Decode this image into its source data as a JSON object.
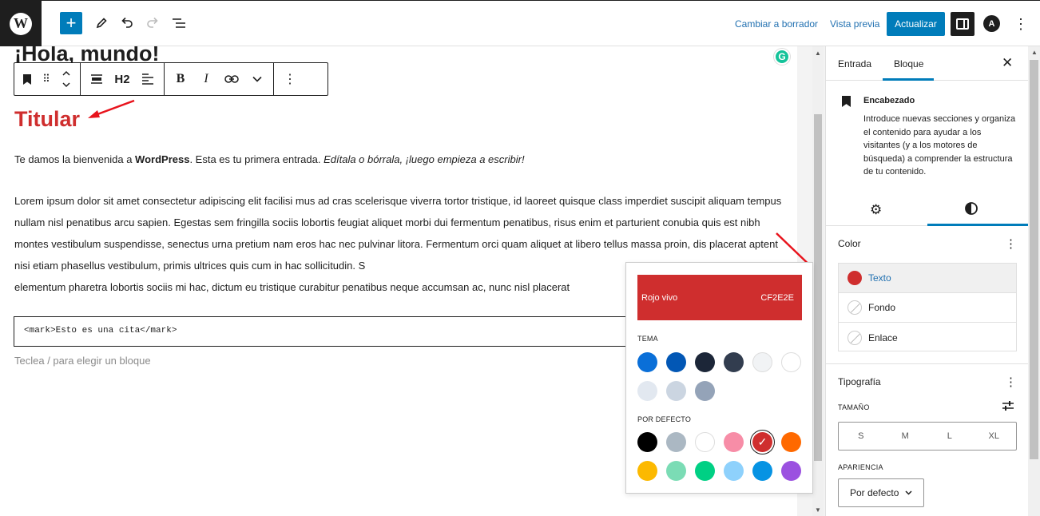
{
  "topbar": {
    "add_icon": "plus-icon",
    "switch_draft": "Cambiar a borrador",
    "preview": "Vista previa",
    "update": "Actualizar",
    "astra_letter": "A"
  },
  "editor": {
    "post_title": "¡Hola, mundo!",
    "toolbar_heading_level": "H2",
    "heading_text": "Titular",
    "intro": {
      "pre": "Te damos la bienvenida a ",
      "bold": "WordPress",
      "mid": ". Esta es tu primera entrada. ",
      "italic": "Edítala o bórrala, ¡luego empieza a escribir!"
    },
    "lorem": "Lorem ipsum dolor sit amet consectetur adipiscing elit facilisi mus ad cras scelerisque viverra tortor tristique, id laoreet quisque class imperdiet suscipit aliquam tempus nullam nisl penatibus arcu sapien. Egestas sem fringilla sociis lobortis feugiat aliquet morbi dui fermentum penatibus, risus enim et parturient conubia quis est nibh montes vestibulum suspendisse, senectus urna pretium nam eros hac nec pulvinar litora. Fermentum orci quam aliquet at libero tellus massa proin, dis placerat aptent nisi etiam phasellus vestibulum, primis ultrices quis cum in hac sollicitudin. S",
    "lorem_last": "elementum pharetra lobortis sociis mi hac, dictum eu tristique curabitur penatibus neque accumsan ac, nunc nisl placerat",
    "code": "<mark>Esto es una cita</mark>",
    "placeholder": "Teclea / para elegir un bloque",
    "grammarly_letter": "G"
  },
  "popover": {
    "selected_name": "Rojo vivo",
    "selected_hex": "CF2E2E",
    "theme_label": "TEMA",
    "default_label": "POR DEFECTO",
    "theme_colors": [
      "#0a6fd8",
      "#0257b5",
      "#1c2638",
      "#323d4f",
      "#f1f3f5",
      "#ffffff",
      "#e2e8f0",
      "#cbd5e1",
      "#94a3b8"
    ],
    "default_colors": [
      "#000000",
      "#abb8c3",
      "#ffffff",
      "#f78da7",
      "#cf2e2e",
      "#ff6900",
      "#fcb900",
      "#7bdcb5",
      "#00d084",
      "#8ed1fc",
      "#0693e3",
      "#9b51e0"
    ],
    "selected_index": 4
  },
  "sidebar": {
    "tab_post": "Entrada",
    "tab_block": "Bloque",
    "block_title": "Encabezado",
    "block_desc": "Introduce nuevas secciones y organiza el contenido para ayudar a los visitantes (y a los motores de búsqueda) a comprender la estructura de tu contenido.",
    "color_title": "Color",
    "color_items": [
      {
        "label": "Texto",
        "color": "#cf2e2e"
      },
      {
        "label": "Fondo"
      },
      {
        "label": "Enlace"
      }
    ],
    "typography_title": "Tipografía",
    "size_label": "TAMAÑO",
    "sizes": [
      "S",
      "M",
      "L",
      "XL"
    ],
    "appearance_label": "APARIENCIA",
    "appearance_value": "Por defecto"
  },
  "colors": {
    "accent": "#007cba",
    "annotation_arrow": "#e8131c"
  }
}
